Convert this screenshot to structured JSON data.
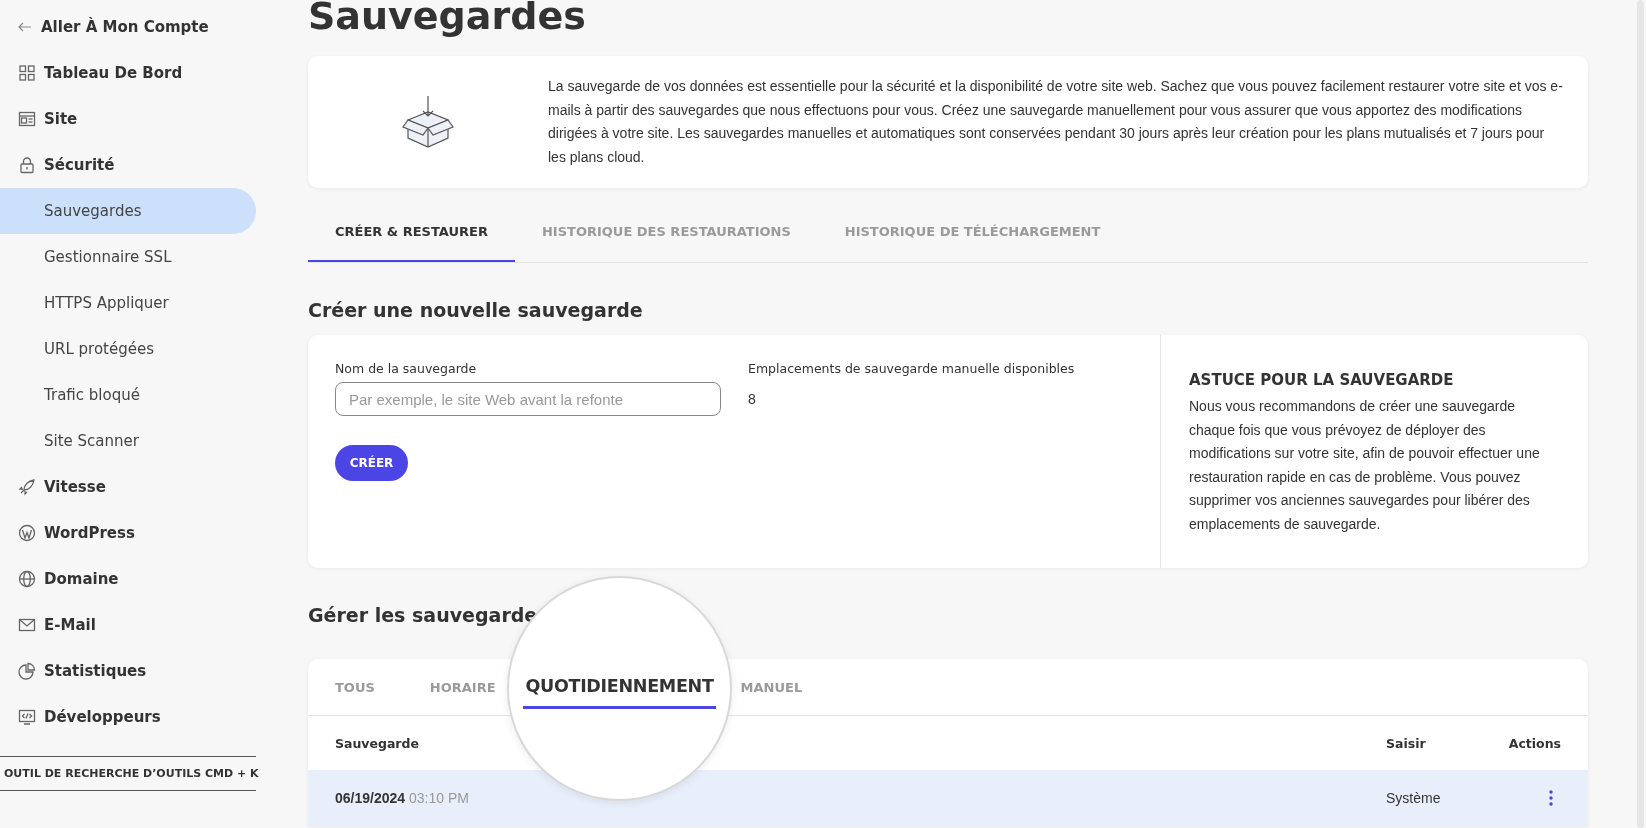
{
  "sidebar": {
    "back_link": "Aller À Mon Compte",
    "items": [
      {
        "label": "Tableau De Bord",
        "selected": false
      },
      {
        "label": "Site",
        "selected": false
      },
      {
        "label": "Sécurité",
        "selected": false,
        "children": [
          {
            "label": "Sauvegardes",
            "selected": true
          },
          {
            "label": "Gestionnaire SSL",
            "selected": false
          },
          {
            "label": "HTTPS Appliquer",
            "selected": false
          },
          {
            "label": "URL protégées",
            "selected": false
          },
          {
            "label": "Trafic bloqué",
            "selected": false
          },
          {
            "label": "Site Scanner",
            "selected": false
          }
        ]
      },
      {
        "label": "Vitesse",
        "selected": false
      },
      {
        "label": "WordPress",
        "selected": false
      },
      {
        "label": "Domaine",
        "selected": false
      },
      {
        "label": "E-Mail",
        "selected": false
      },
      {
        "label": "Statistiques",
        "selected": false
      },
      {
        "label": "Développeurs",
        "selected": false
      }
    ],
    "tool_search": "OUTIL DE RECHERCHE D’OUTILS CMD + K"
  },
  "page_title": "Sauvegardes",
  "intro": "La sauvegarde de vos données est essentielle pour la sécurité et la disponibilité de votre site web. Sachez que vous pouvez facilement restaurer votre site et vos e-mails à partir des sauvegardes que nous effectuons pour vous. Créez une sauvegarde manuellement pour vous assurer que vous apportez des modifications dirigées à votre site. Les sauvegardes manuelles et automatiques sont conservées pendant 30 jours après leur création pour les plans mutualisés et 7 jours pour les plans cloud.",
  "tabs": [
    {
      "label": "CRÉER & RESTAURER",
      "selected": true
    },
    {
      "label": "HISTORIQUE DES RESTAURATIONS",
      "selected": false
    },
    {
      "label": "HISTORIQUE DE TÉLÉCHARGEMENT",
      "selected": false
    }
  ],
  "create": {
    "heading": "Créer une nouvelle sauvegarde",
    "name_label": "Nom de la sauvegarde",
    "name_placeholder": "Par exemple, le site Web avant la refonte",
    "slots_label": "Emplacements de sauvegarde manuelle disponibles",
    "slots_value": "8",
    "button": "CRÉER",
    "tip_title": "ASTUCE POUR LA SAUVEGARDE",
    "tip_text": "Nous vous recommandons de créer une sauvegarde chaque fois que vous prévoyez de déployer des modifications sur votre site, afin de pouvoir effectuer une restauration rapide en cas de problème. Vous pouvez supprimer vos anciennes sauvegardes pour libérer des emplacements de sauvegarde."
  },
  "manage": {
    "heading": "Gérer les sauvegarde",
    "filters": [
      {
        "label": "TOUS",
        "selected": false
      },
      {
        "label": "HORAIRE",
        "selected": false
      },
      {
        "label": "QUOTIDIENNEMENT",
        "selected": true
      },
      {
        "label": "MANUEL",
        "selected": false
      }
    ],
    "columns": [
      "Sauvegarde",
      "Saisir",
      "Actions"
    ],
    "rows": [
      {
        "date": "06/19/2024",
        "time": "03:10 PM",
        "source": "Système",
        "selected": true
      }
    ]
  }
}
